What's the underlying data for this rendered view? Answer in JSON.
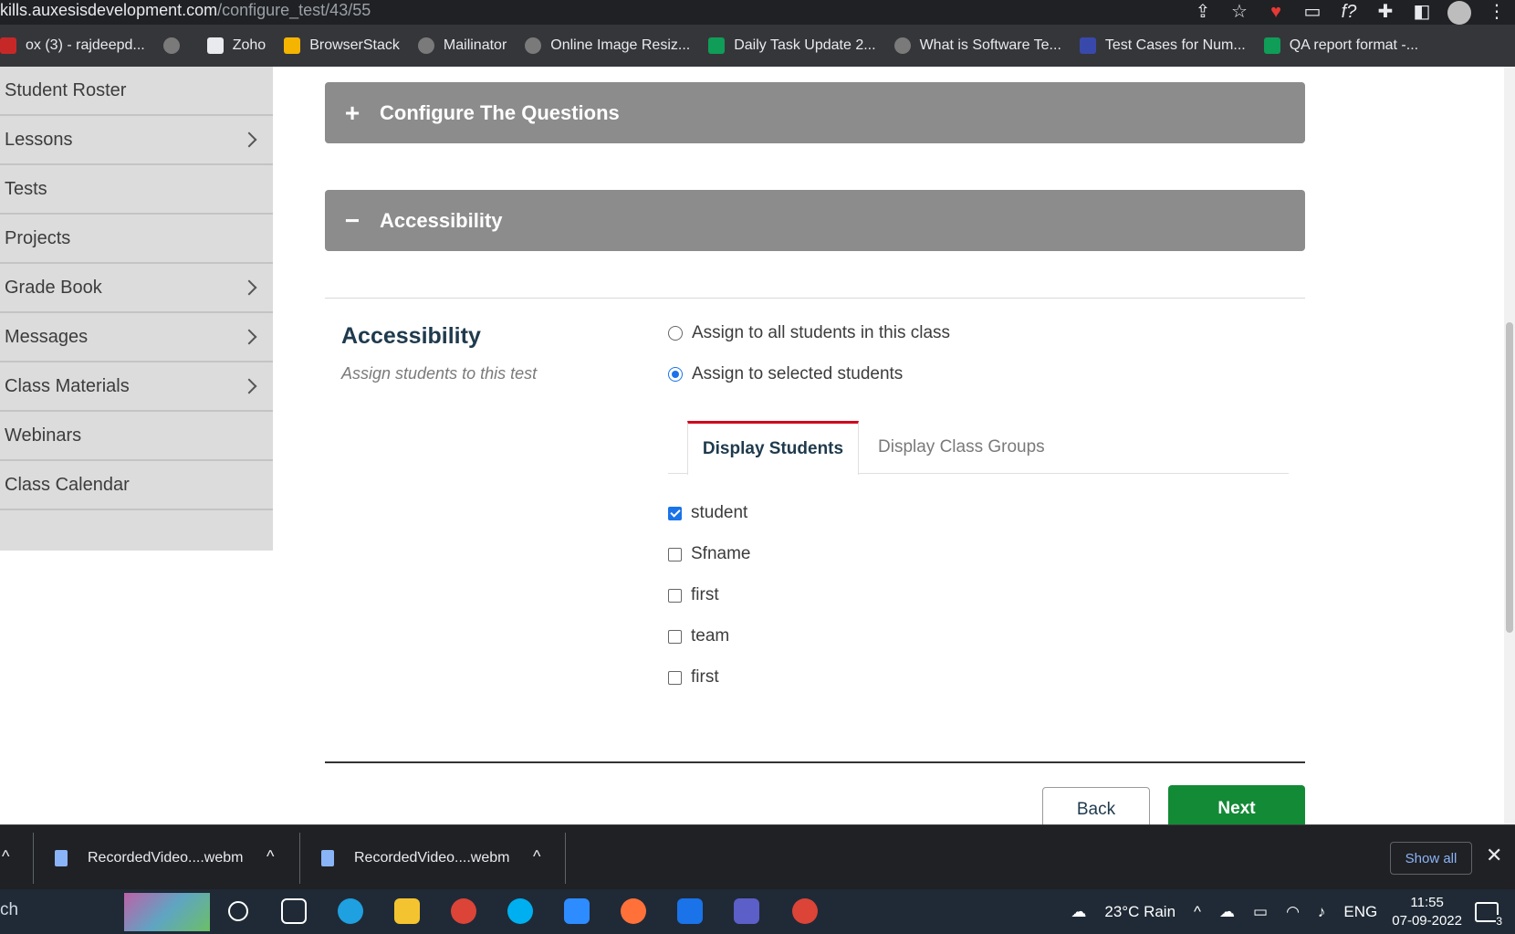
{
  "browser": {
    "url_host": "kills.auxesisdevelopment.com",
    "url_path": "/configure_test/43/55",
    "bookmarks": [
      {
        "label": "ox (3) - rajdeepd...",
        "color": "#c62828"
      },
      {
        "label": "",
        "color": "#7a7a7a"
      },
      {
        "label": "Zoho",
        "color": "#e8eaed"
      },
      {
        "label": "BrowserStack",
        "color": "#f4b400"
      },
      {
        "label": "Mailinator",
        "color": "#7a7a7a"
      },
      {
        "label": "Online Image Resiz...",
        "color": "#7a7a7a"
      },
      {
        "label": "Daily Task Update 2...",
        "color": "#0f9d58"
      },
      {
        "label": "What is Software Te...",
        "color": "#7a7a7a"
      },
      {
        "label": "Test Cases for Num...",
        "color": "#3949ab"
      },
      {
        "label": "QA report format -...",
        "color": "#0f9d58"
      }
    ]
  },
  "sidebar": {
    "items": [
      {
        "label": "Student Roster",
        "chevron": false
      },
      {
        "label": "Lessons",
        "chevron": true
      },
      {
        "label": "Tests",
        "chevron": false
      },
      {
        "label": "Projects",
        "chevron": false
      },
      {
        "label": "Grade Book",
        "chevron": true
      },
      {
        "label": "Messages",
        "chevron": true
      },
      {
        "label": "Class Materials",
        "chevron": true
      },
      {
        "label": "Webinars",
        "chevron": false
      },
      {
        "label": "Class Calendar",
        "chevron": false
      }
    ]
  },
  "panels": {
    "configure": {
      "icon": "+",
      "label": "Configure The Questions"
    },
    "accessibility": {
      "icon": "−",
      "label": "Accessibility"
    }
  },
  "accessibility": {
    "title": "Accessibility",
    "subtitle": "Assign students to this test",
    "options": [
      {
        "label": "Assign to all students in this class",
        "selected": false
      },
      {
        "label": "Assign to selected students",
        "selected": true
      }
    ],
    "tabs": [
      {
        "label": "Display Students",
        "active": true
      },
      {
        "label": "Display Class Groups",
        "active": false
      }
    ],
    "students": [
      {
        "label": "student",
        "checked": true
      },
      {
        "label": "Sfname",
        "checked": false
      },
      {
        "label": "first",
        "checked": false
      },
      {
        "label": "team",
        "checked": false
      },
      {
        "label": "first",
        "checked": false
      }
    ]
  },
  "actions": {
    "back": "Back",
    "next": "Next"
  },
  "downloads": {
    "items": [
      "RecordedVideo....webm",
      "RecordedVideo....webm"
    ],
    "show_all": "Show all"
  },
  "taskbar": {
    "search": "ch",
    "weather": "23°C  Rain",
    "lang": "ENG",
    "time": "11:55",
    "date": "07-09-2022",
    "notifications": "3"
  }
}
